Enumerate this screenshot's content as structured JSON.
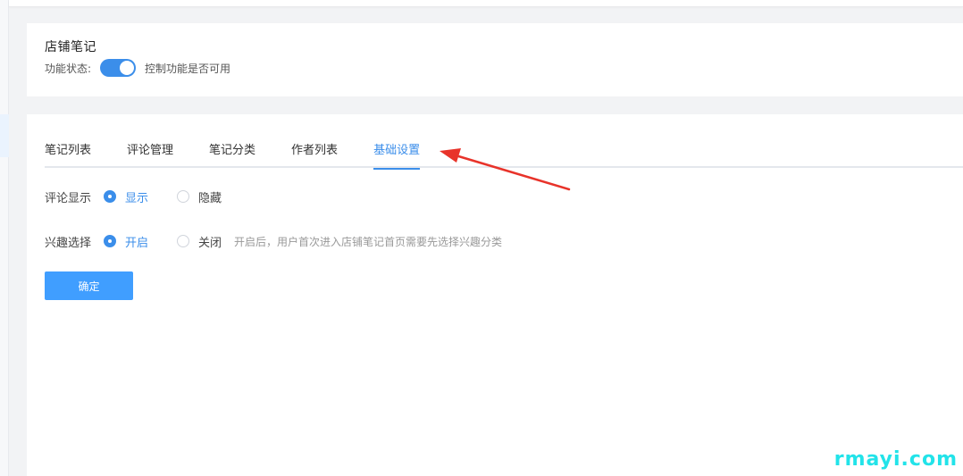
{
  "store_notes": {
    "title": "店铺笔记",
    "status_label": "功能状态:",
    "status_desc": "控制功能是否可用",
    "enabled": true
  },
  "tabs": [
    {
      "label": "笔记列表",
      "active": false
    },
    {
      "label": "评论管理",
      "active": false
    },
    {
      "label": "笔记分类",
      "active": false
    },
    {
      "label": "作者列表",
      "active": false
    },
    {
      "label": "基础设置",
      "active": true
    }
  ],
  "settings": {
    "comment_display": {
      "label": "评论显示",
      "options": [
        "显示",
        "隐藏"
      ],
      "selected": "显示"
    },
    "interest_select": {
      "label": "兴趣选择",
      "options": [
        "开启",
        "关闭"
      ],
      "selected": "开启",
      "hint": "开启后，用户首次进入店铺笔记首页需要先选择兴趣分类"
    },
    "confirm_label": "确定"
  },
  "annotation": {
    "color": "#e8332a"
  },
  "watermark": "rmayi.com",
  "colors": {
    "accent": "#3b8eea",
    "button": "#409eff"
  }
}
